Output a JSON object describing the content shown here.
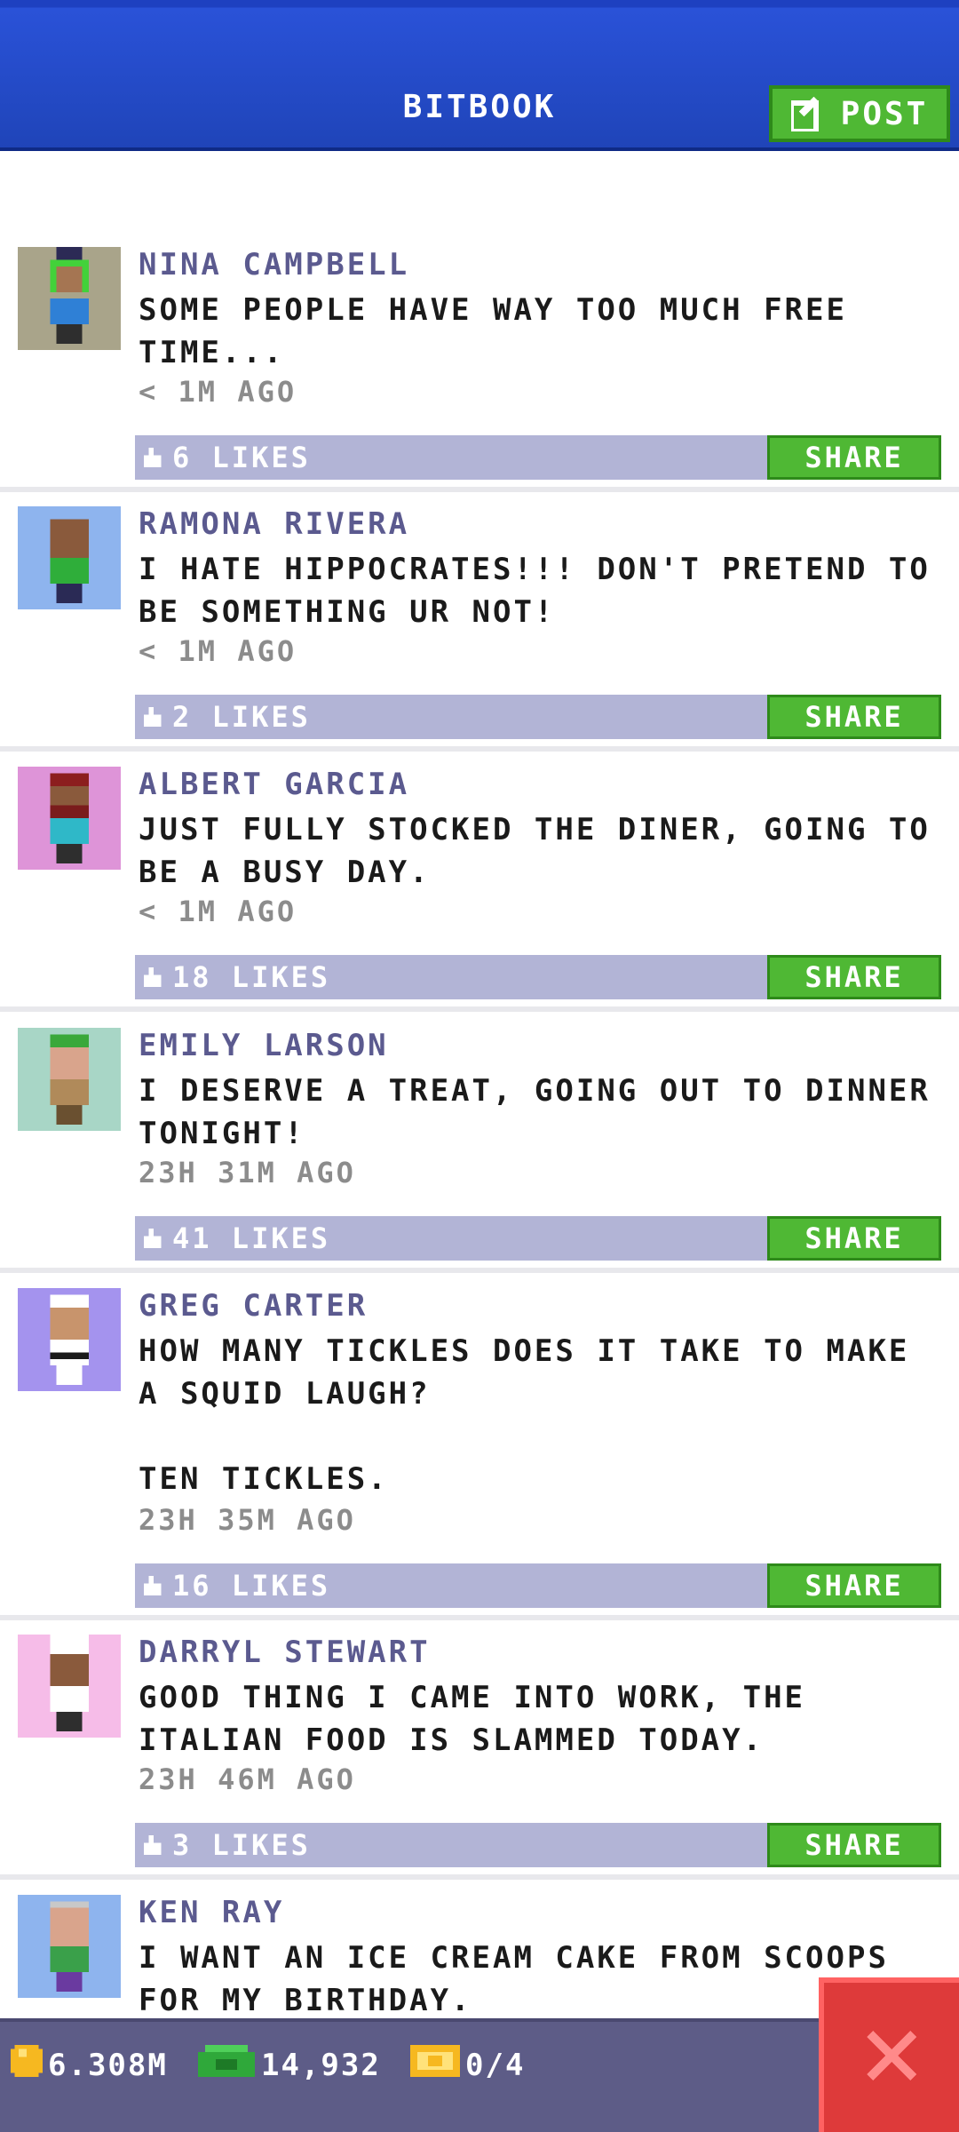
{
  "header": {
    "title": "BITBOOK",
    "post_label": "POST",
    "color": "#1f44b8"
  },
  "colors": {
    "accent_green": "#4fb834",
    "name_purple": "#5b5a8f",
    "like_bar": "#b2b4d6",
    "bottom_bar": "#5d5c87",
    "close_red": "#de3a3a"
  },
  "posts": [
    {
      "name": "NINA CAMPBELL",
      "text": "SOME PEOPLE HAVE WAY TOO MUCH FREE TIME...",
      "time": "< 1M AGO",
      "likes": "6 LIKES",
      "share": "SHARE",
      "avatar": "pixel-avatar-green-hair"
    },
    {
      "name": "RAMONA RIVERA",
      "text": "I HATE HIPPOCRATES!!! DON'T PRETEND TO BE SOMETHING UR NOT!",
      "time": "< 1M AGO",
      "likes": "2 LIKES",
      "share": "SHARE",
      "avatar": "pixel-avatar-bald"
    },
    {
      "name": "ALBERT GARCIA",
      "text": "JUST FULLY STOCKED THE DINER, GOING TO BE A BUSY DAY.",
      "time": "< 1M AGO",
      "likes": "18 LIKES",
      "share": "SHARE",
      "avatar": "pixel-avatar-bearded"
    },
    {
      "name": "EMILY LARSON",
      "text": "I DESERVE A TREAT, GOING OUT TO DINNER TONIGHT!",
      "time": "23H 31M AGO",
      "likes": "41 LIKES",
      "share": "SHARE",
      "avatar": "pixel-avatar-green-cap"
    },
    {
      "name": "GREG CARTER",
      "text": "HOW MANY TICKLES DOES IT TAKE TO MAKE A SQUID LAUGH?\n\nTEN TICKLES.",
      "time": "23H 35M AGO",
      "likes": "16 LIKES",
      "share": "SHARE",
      "avatar": "pixel-avatar-karate"
    },
    {
      "name": "DARRYL STEWART",
      "text": "GOOD THING I CAME INTO WORK, THE ITALIAN FOOD IS SLAMMED TODAY.",
      "time": "23H 46M AGO",
      "likes": "3 LIKES",
      "share": "SHARE",
      "avatar": "pixel-avatar-chef"
    },
    {
      "name": "KEN RAY",
      "text": "I WANT AN ICE CREAM CAKE FROM SCOOPS FOR MY BIRTHDAY.",
      "time": "",
      "likes": "",
      "share": "",
      "avatar": "pixel-avatar-old-man"
    }
  ],
  "bottom_bar": {
    "coins": "6.308M",
    "bux": "14,932",
    "tickets": "0/4"
  }
}
